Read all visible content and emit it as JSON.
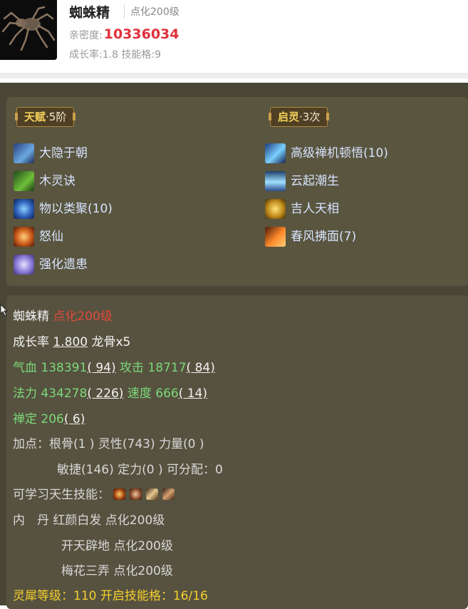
{
  "header": {
    "pet_name": "蜘蛛精",
    "pet_tag": "点化200级",
    "intimacy_label": "亲密度:",
    "intimacy_value": "10336034",
    "growth_skills": "成长率:1.8  技能格:9"
  },
  "talent": {
    "label": "天赋",
    "level": "·5阶",
    "skills": [
      "大隐于朝",
      "木灵诀",
      "物以类聚(10)",
      "怒仙",
      "强化遗患"
    ]
  },
  "qiling": {
    "label": "启灵",
    "times": "·3次",
    "skills": [
      "高级禅机顿悟(10)",
      "云起潮生",
      "吉人天相",
      "春风拂面(7)"
    ]
  },
  "detail": {
    "name": "蜘蛛精",
    "tag": "点化200级",
    "growth_label": "成长率",
    "growth_value": "1.800",
    "growth_extra": "龙骨x5",
    "hp_label": "气血",
    "hp_value": "138391",
    "hp_bonus": "( 94)",
    "atk_label": "攻击",
    "atk_value": "18717",
    "atk_bonus": "( 84)",
    "mp_label": "法力",
    "mp_value": "434278",
    "mp_bonus": "( 226)",
    "spd_label": "速度",
    "spd_value": "666",
    "spd_bonus": "( 14)",
    "chanding_label": "禅定",
    "chanding_value": "206",
    "chanding_bonus": "( 6)",
    "points_line1": "加点：根骨(1 ) 灵性(743) 力量(0 )",
    "points_line2": "敏捷(146) 定力(0 ) 可分配：0",
    "learnable_label": "可学习天生技能：",
    "neidan_label": "内　丹",
    "neidan": [
      "红颜白发 点化200级",
      "开天辟地 点化200级",
      "梅花三弄 点化200级"
    ],
    "lingxi": "灵犀等级：110 开启技能格：16/16"
  }
}
